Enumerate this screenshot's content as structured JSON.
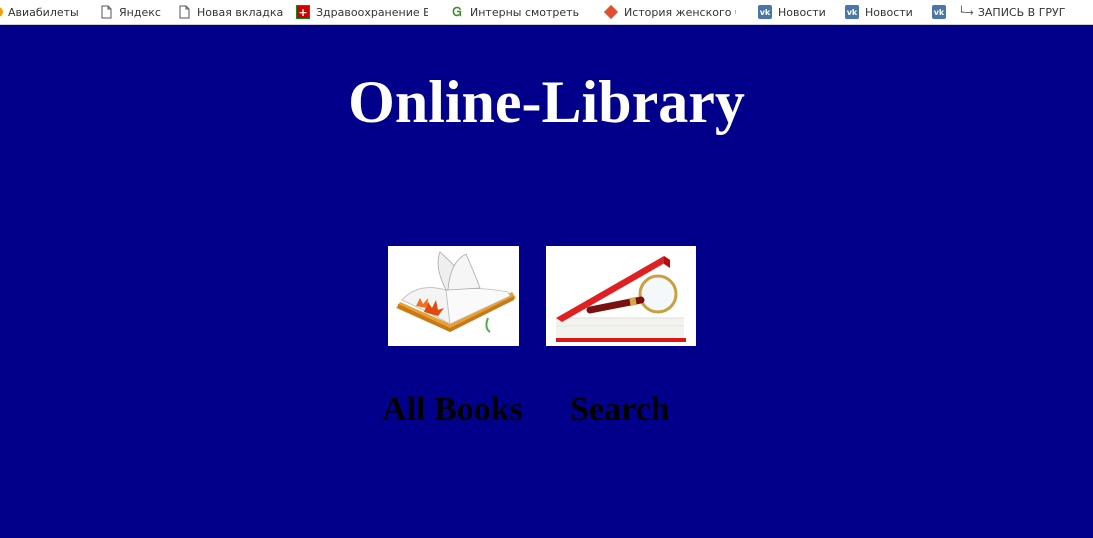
{
  "bookmarks": [
    {
      "label": "Авиабилеты",
      "icon": "partial-icon"
    },
    {
      "label": "Яндекс",
      "icon": "page-icon"
    },
    {
      "label": "Новая вкладка",
      "icon": "page-icon"
    },
    {
      "label": "Здравоохранение Бе",
      "icon": "health-cross-icon"
    },
    {
      "label": "Интерны смотреть с",
      "icon": "green-logo-icon"
    },
    {
      "label": "История женского б",
      "icon": "diamond-icon"
    },
    {
      "label": "Новости",
      "icon": "vk-icon"
    },
    {
      "label": "Новости",
      "icon": "vk-icon"
    },
    {
      "label": "",
      "icon": "vk-icon"
    },
    {
      "label": "ЗАПИСЬ В ГРУГ",
      "icon": "arrow-icon"
    }
  ],
  "page": {
    "title": "Online-Library",
    "background": "#02008a"
  },
  "links": {
    "all_books": "All Books",
    "search": "Search"
  },
  "images": {
    "all_books": "open-book-with-maple-leaves",
    "search": "red-book-with-magnifying-glass"
  }
}
